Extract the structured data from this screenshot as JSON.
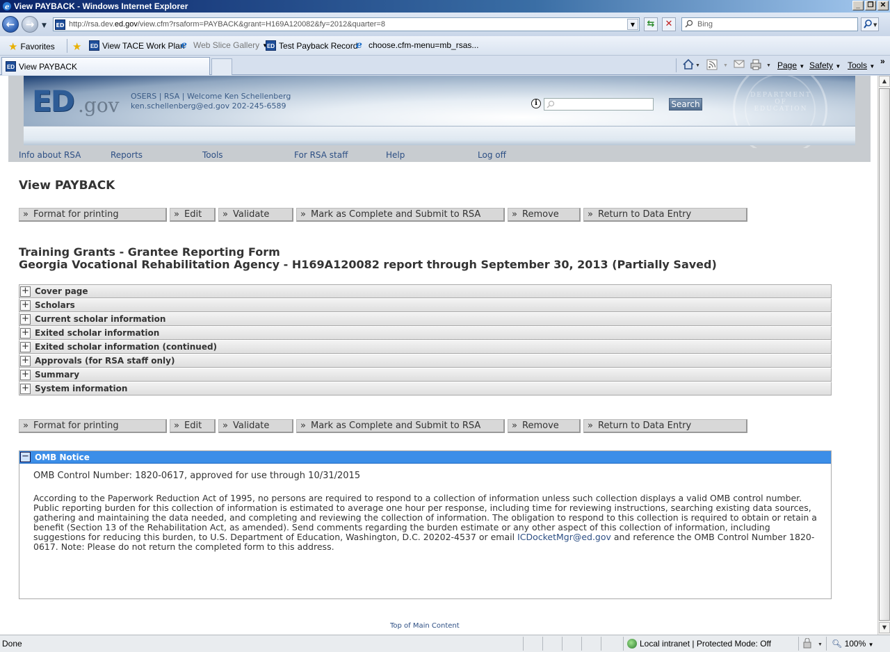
{
  "browser": {
    "window_title": "View PAYBACK - Windows Internet Explorer",
    "window_buttons": [
      "_",
      "❐",
      "✕"
    ],
    "url_prefix": "http://rsa.dev.",
    "url_domain": "ed.gov",
    "url_path": "/view.cfm?rsaform=PAYBACK&grant=H169A120082&fy=2012&quarter=8",
    "search_placeholder": "Bing",
    "favorites_label": "Favorites",
    "favorites": [
      {
        "label": "View TACE Work Plan",
        "icon": "ed-icon"
      },
      {
        "label": "Web Slice Gallery",
        "icon": "ie-icon",
        "dropdown": true
      },
      {
        "label": "Test Payback Record",
        "icon": "ed-icon"
      },
      {
        "label": "choose.cfm-menu=mb_rsas...",
        "icon": "ie-icon"
      }
    ],
    "tab_title": "View PAYBACK",
    "commands": {
      "page": "Page",
      "safety": "Safety",
      "tools": "Tools"
    },
    "status_text": "Done",
    "zone_text": "Local intranet | Protected Mode: Off",
    "zoom_text": "100%"
  },
  "site_header": {
    "logo_ed": "ED",
    "logo_gov": ".gov",
    "line1": "OSERS | RSA | Welcome Ken Schellenberg",
    "line2": "ken.schellenberg@ed.gov 202-245-6589",
    "search_button": "Search",
    "seal_text": "DEPARTMENT OF EDUCATION"
  },
  "nav": [
    "Info about RSA",
    "Reports",
    "Tools",
    "For RSA staff",
    "Help",
    "Log off"
  ],
  "page_title": "View PAYBACK",
  "actions": [
    "Format for printing",
    "Edit",
    "Validate",
    "Mark as Complete and Submit to RSA",
    "Remove",
    "Return to Data Entry"
  ],
  "form_title": {
    "line1": "Training Grants - Grantee Reporting Form",
    "line2": "Georgia Vocational Rehabilitation Agency - H169A120082 report through September 30, 2013 (Partially Saved)"
  },
  "sections": [
    "Cover page",
    "Scholars",
    "Current scholar information",
    "Exited scholar information",
    "Exited scholar information (continued)",
    "Approvals (for RSA staff only)",
    "Summary",
    "System information"
  ],
  "omb": {
    "heading": "OMB Notice",
    "control": "OMB Control Number: 1820-0617, approved for use through 10/31/2015",
    "body_part1": "According to the Paperwork Reduction Act of 1995, no persons are required to respond to a collection of information unless such collection displays a valid OMB control number. Public reporting burden for this collection of information is estimated to average one hour per response, including time for reviewing instructions, searching existing data sources, gathering and maintaining the data needed, and completing and reviewing the collection of information. The obligation to respond to this collection is required to obtain or retain a benefit (Section 13 of the Rehabilitation Act, as amended). Send comments regarding the burden estimate or any other aspect of this collection of information, including suggestions for reducing this burden, to U.S. Department of Education, Washington, D.C. 20202-4537 or email ",
    "email_link": "ICDocketMgr@ed.gov",
    "body_part2": " and reference the OMB Control Number 1820-0617. Note: Please do not return the completed form to this address."
  },
  "top_link": "Top of Main Content"
}
